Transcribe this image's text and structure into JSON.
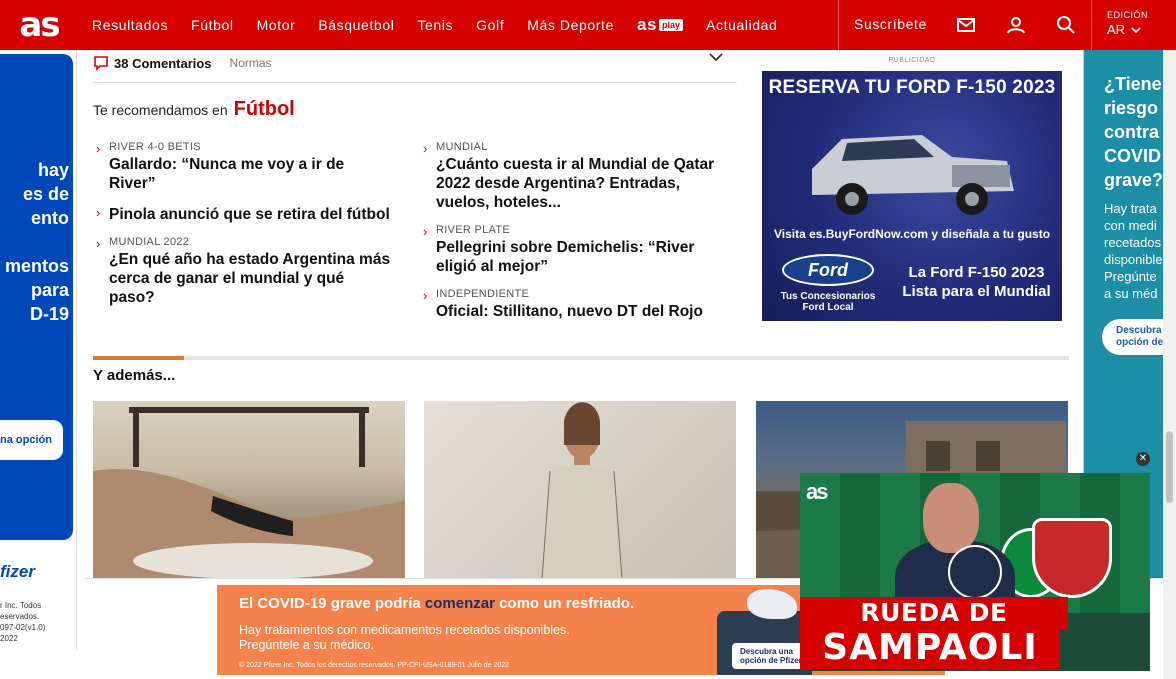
{
  "header": {
    "logo": "as",
    "nav": [
      "Resultados",
      "Fútbol",
      "Motor",
      "Básquetbol",
      "Tenis",
      "Golf",
      "Más Deporte"
    ],
    "asplay_logo": "as",
    "asplay_badge": "play",
    "nav_last": "Actualidad",
    "subscribe": "Suscríbete",
    "edition_label": "EDICIÓN",
    "edition_value": "AR",
    "icons": [
      "mail-icon",
      "user-icon",
      "search-icon",
      "chevron-down-icon"
    ],
    "color": "#d50000"
  },
  "comments": {
    "count_label": "38 Comentarios",
    "norms": "Normas"
  },
  "recommended": {
    "prefix": "Te recomendamos en",
    "section": "Fútbol",
    "left": [
      {
        "kicker": "RIVER 4-0 BETIS",
        "headline": "Gallardo: “Nunca me voy a ir de River”"
      },
      {
        "kicker": "",
        "headline": "Pinola anunció que se retira del fútbol"
      },
      {
        "kicker": "MUNDIAL 2022",
        "headline": "¿En qué año ha estado Argentina más cerca de ganar el mundial y qué paso?"
      }
    ],
    "right": [
      {
        "kicker": "MUNDIAL",
        "headline": "¿Cuánto cuesta ir al Mundial de Qatar 2022 desde Argentina? Entradas, vuelos, hoteles..."
      },
      {
        "kicker": "RIVER PLATE",
        "headline": "Pellegrini sobre Demichelis: “River eligió al mejor”"
      },
      {
        "kicker": "INDEPENDIENTE",
        "headline": "Oficial: Stillitano, nuevo DT del Rojo"
      }
    ]
  },
  "further": {
    "title": "Y además...",
    "accent_color": "#e0782a"
  },
  "ads": {
    "publicidad": "PUBLICIDAD",
    "ford": {
      "headline": "RESERVA TU FORD F-150 2023",
      "visit": "Visita es.BuyFordNow.com y diseñala a tu gusto",
      "brand": "Ford",
      "dealers": "Tus Concesionarios Ford Local",
      "promo": "La Ford F-150 2023 Lista para el Mundial"
    },
    "left_pfizer": {
      "text": "hay\nes de\nento\n\nmentos\npara\nD-19",
      "button": "na opción",
      "brand": "fizer",
      "legal": "r Inc. Todos\neservados.\n097-02(v1.0)\n2022"
    },
    "right_pfizer": {
      "question": "¿Tiene\nriesgo\ncontra\nCOVID\ngrave?",
      "desc": "Hay trata\ncon medi\nrecetados\ndisponible\nPregúnte\na su méd",
      "button": "Descubra\nopción de"
    },
    "bottom_banner": {
      "line1_start": "El COVID-19 grave podría ",
      "line1_highlight": "comenzar",
      "line1_end": " como un resfriado.",
      "line2": "Hay tratamientos con medicamentos recetados disponibles.\nPregúntele a su médico.",
      "legal": "© 2022 Pfizer Inc. Todos los derechos reservados. PP-CPI-USA-0189-01 Julio de 2022",
      "cta": "Descubra una\nopción de Pfizer"
    }
  },
  "video": {
    "logo": "as",
    "caption1": "RUEDA DE PRENSA",
    "caption2": "SAMPAOLI",
    "close": "✕"
  }
}
